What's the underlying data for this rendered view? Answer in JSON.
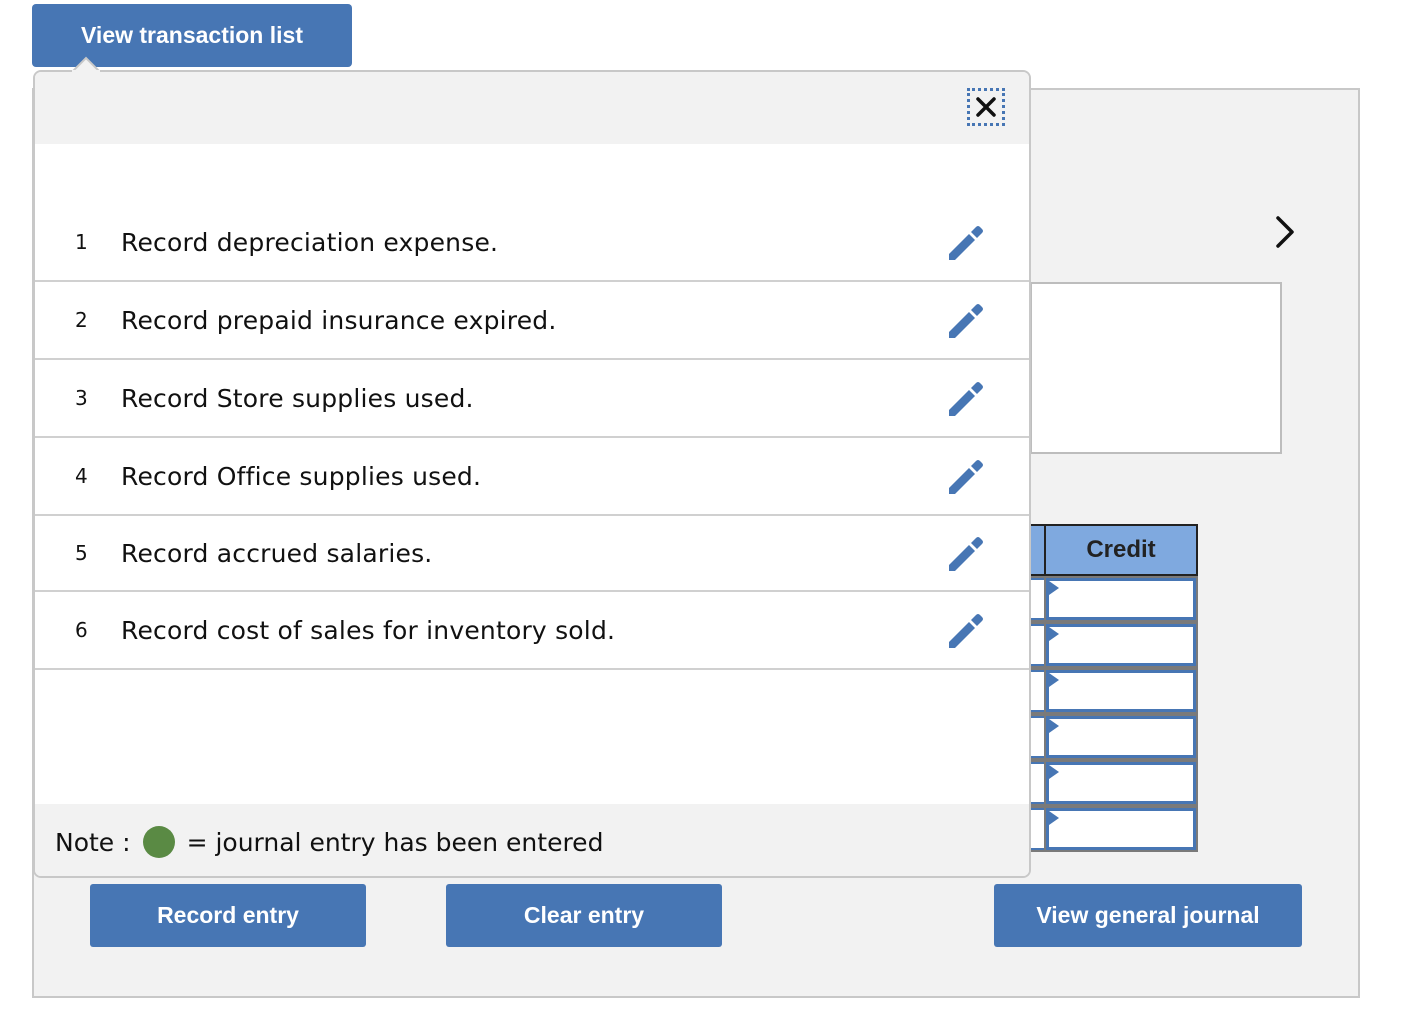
{
  "header": {
    "view_transaction_list_label": "View transaction list"
  },
  "popup": {
    "close_icon": "close-icon",
    "transactions": [
      {
        "number": "1",
        "description": "Record depreciation expense.",
        "icon": "pencil-icon"
      },
      {
        "number": "2",
        "description": "Record prepaid insurance expired.",
        "icon": "pencil-icon"
      },
      {
        "number": "3",
        "description": "Record Store supplies used.",
        "icon": "pencil-icon"
      },
      {
        "number": "4",
        "description": "Record Office supplies used.",
        "icon": "pencil-icon"
      },
      {
        "number": "5",
        "description": "Record accrued salaries.",
        "icon": "pencil-icon"
      },
      {
        "number": "6",
        "description": "Record cost of sales for inventory sold.",
        "icon": "pencil-icon"
      }
    ],
    "note": {
      "prefix": "Note :",
      "suffix": "= journal entry has been entered",
      "dot_color": "#5a8a44"
    }
  },
  "journal": {
    "credit_header": "Credit",
    "rows": [
      "",
      "",
      "",
      "",
      "",
      ""
    ]
  },
  "buttons": {
    "record_entry": "Record entry",
    "clear_entry": "Clear entry",
    "view_general_journal": "View general journal"
  },
  "colors": {
    "accent": "#4776b4",
    "header_blue": "#7fa9df",
    "panel_bg": "#f2f2f2"
  }
}
